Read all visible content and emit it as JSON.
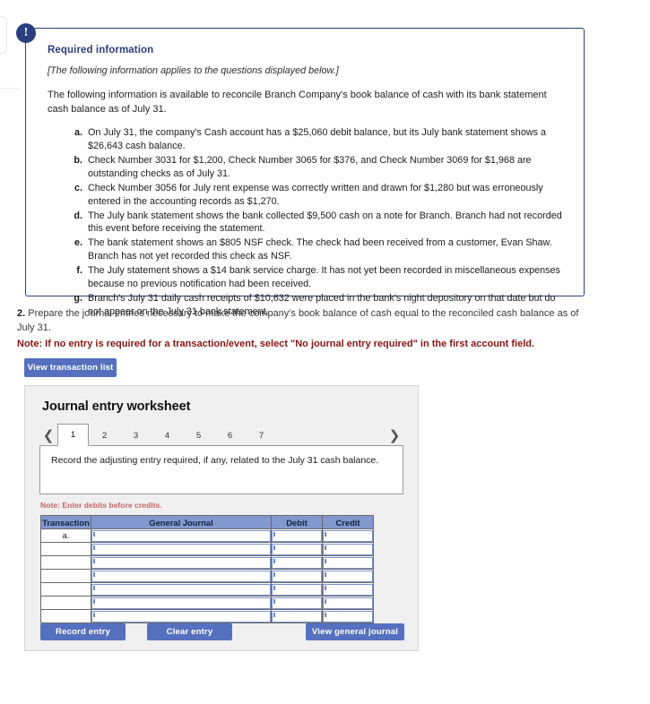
{
  "callout": {
    "badge_icon": "exclamation-icon",
    "badge_glyph": "!",
    "title": "Required information",
    "applies_note": "[The following information applies to the questions displayed below.]",
    "lead": "The following information is available to reconcile Branch Company's book balance of cash with its bank statement cash balance as of July 31.",
    "facts": [
      "On July 31, the company's Cash account has a $25,060 debit balance, but its July bank statement shows a $26,643 cash balance.",
      "Check Number 3031 for $1,200, Check Number 3065 for $376, and Check Number 3069 for $1,968 are outstanding checks as of July 31.",
      "Check Number 3056 for July rent expense was correctly written and drawn for $1,280 but was erroneously entered in the accounting records as $1,270.",
      "The July bank statement shows the bank collected $9,500 cash on a note for Branch. Branch had not recorded this event before receiving the statement.",
      "The bank statement shows an $805 NSF check. The check had been received from a customer, Evan Shaw. Branch has not yet recorded this check as NSF.",
      "The July statement shows a $14 bank service charge. It has not yet been recorded in miscellaneous expenses because no previous notification had been received.",
      "Branch's July 31 daily cash receipts of $10,632 were placed in the bank's night depository on that date but do not appear on the July 31 bank statement."
    ]
  },
  "question": {
    "number": "2.",
    "text": "Prepare the journal entries necessary to make the company's book balance of cash equal to the reconciled cash balance as of July 31.",
    "note": "Note: If no entry is required for a transaction/event, select \"No journal entry required\" in the first account field."
  },
  "toolbar": {
    "view_transaction_list_label": "View transaction list"
  },
  "worksheet": {
    "title": "Journal entry worksheet",
    "pager": {
      "prev_icon": "chevron-left-icon",
      "next_icon": "chevron-right-icon",
      "tabs": [
        "1",
        "2",
        "3",
        "4",
        "5",
        "6",
        "7"
      ],
      "active_tab": "1"
    },
    "instruction": "Record the adjusting entry required, if any, related to the July 31 cash balance.",
    "subnote": "Note: Enter debits before credits.",
    "table": {
      "columns": [
        "Transaction",
        "General Journal",
        "Debit",
        "Credit"
      ],
      "rows": [
        {
          "transaction": "a.",
          "general_journal": "",
          "debit": "",
          "credit": ""
        },
        {
          "transaction": "",
          "general_journal": "",
          "debit": "",
          "credit": ""
        },
        {
          "transaction": "",
          "general_journal": "",
          "debit": "",
          "credit": ""
        },
        {
          "transaction": "",
          "general_journal": "",
          "debit": "",
          "credit": ""
        },
        {
          "transaction": "",
          "general_journal": "",
          "debit": "",
          "credit": ""
        },
        {
          "transaction": "",
          "general_journal": "",
          "debit": "",
          "credit": ""
        },
        {
          "transaction": "",
          "general_journal": "",
          "debit": "",
          "credit": ""
        }
      ]
    },
    "actions": {
      "record_entry_label": "Record entry",
      "clear_entry_label": "Clear entry",
      "view_general_journal_label": "View general journal"
    }
  },
  "colors": {
    "callout_border": "#2b3f80",
    "callout_title": "#2b3f80",
    "button_primary": "#5570bf",
    "note_red": "#8a1515",
    "subnote_red": "#c86464",
    "table_header": "#8298cf",
    "panel_bg": "#f0f0f0"
  }
}
